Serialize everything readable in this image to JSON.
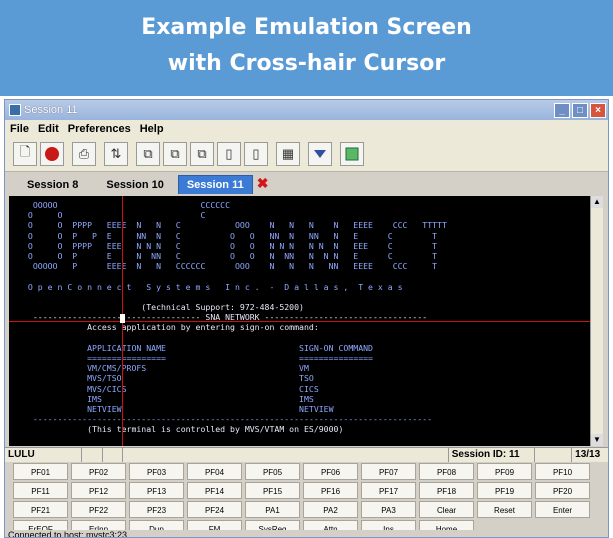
{
  "banner": {
    "line1": "Example Emulation Screen",
    "line2": "with Cross-hair Cursor"
  },
  "window": {
    "title": "Session 11"
  },
  "menu": [
    "File",
    "Edit",
    "Preferences",
    "Help"
  ],
  "toolbar": {
    "icons": [
      "new-icon",
      "stop-icon",
      "print-icon",
      "transfer-icon",
      "copy-icon",
      "paste-icon",
      "paste-special-icon",
      "clipboard-icon",
      "clipboard-append-icon",
      "grid-icon",
      "dropdown-icon",
      "macro-icon"
    ]
  },
  "tabs": [
    "Session 8",
    "Session 10",
    "Session 11"
  ],
  "terminal": {
    "lines": [
      "  OOOOO                             CCCCCC",
      " O     O                            C",
      " O     O  PPPP   EEEE  N   N   C           OOO    N   N   N    N   EEEE    CCC   TTTTT",
      " O     O  P   P  E     NN  N   C          O   O   NN  N   NN   N   E      C        T",
      " O     O  PPPP   EEE   N N N   C          O   O   N N N   N N  N   EEE    C        T",
      " O     O  P      E     N  NN   C          O   O   N  NN   N  N N   E      C        T",
      "  OOOOO   P      EEEE  N   N   CCCCCC      OOO    N   N   N   NN   EEEE    CCC     T",
      "",
      " O p e n C o n n e c t   S y s t e m s   I n c .  -  D a l l a s ,  T e x a s",
      "",
      "                        (Technical Support: 972-484-5200)",
      "  ---------------------------------- SNA NETWORK ---------------------------------",
      "             Access application by entering sign-on command:",
      "",
      "             APPLICATION NAME                           SIGN-ON COMMAND",
      "             ================                           ===============",
      "             VM/CMS/PROFS                               VM",
      "             MVS/TSO                                    TSO",
      "             MVS/CICS                                   CICS",
      "             IMS                                        IMS",
      "             NETVIEW                                    NETVIEW",
      "  ---------------------------------------------------------------------------------",
      "             (This terminal is controlled by MVS/VTAM on ES/9000)"
    ]
  },
  "status": {
    "lu": "LULU",
    "session_id": "Session ID: 11",
    "page": "13/13"
  },
  "keys": [
    [
      "PF01",
      "PF02",
      "PF03",
      "PF04",
      "PF05",
      "PF06",
      "PF07",
      "PF08",
      "PF09",
      "PF10"
    ],
    [
      "PF11",
      "PF12",
      "PF13",
      "PF14",
      "PF15",
      "PF16",
      "PF17",
      "PF18",
      "PF19",
      "PF20"
    ],
    [
      "PF21",
      "PF22",
      "PF23",
      "PF24",
      "PA1",
      "PA2",
      "PA3",
      "Clear",
      "Reset",
      "Enter"
    ],
    [
      "ErEOF",
      "ErInp",
      "Dup",
      "FM",
      "SysReq",
      "Attn",
      "Ins",
      "Home"
    ]
  ],
  "connection": "Connected to host: mvstc3:23"
}
